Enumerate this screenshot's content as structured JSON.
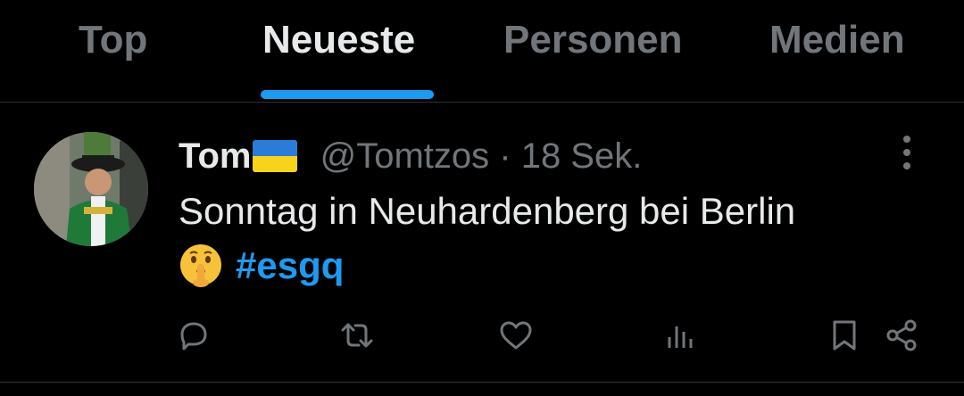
{
  "tabs": [
    {
      "label": "Top",
      "active": false
    },
    {
      "label": "Neueste",
      "active": true
    },
    {
      "label": "Personen",
      "active": false
    },
    {
      "label": "Medien",
      "active": false
    }
  ],
  "tweet": {
    "name": "Tom",
    "flag": "ukraine-flag-emoji",
    "handle": "@Tomtzos",
    "separator": "·",
    "time": "18 Sek.",
    "text_line1": "Sonntag in Neuhardenberg bei Berlin",
    "emoji": "shushing-face-emoji",
    "hashtag": "#esgq"
  },
  "actions": [
    "reply-icon",
    "retweet-icon",
    "like-icon",
    "views-icon",
    "bookmark-icon",
    "share-icon"
  ],
  "colors": {
    "background": "#000000",
    "accent": "#1d9bf0",
    "text": "#e7e9ea",
    "muted": "#71767b",
    "divider": "#2f3336"
  }
}
